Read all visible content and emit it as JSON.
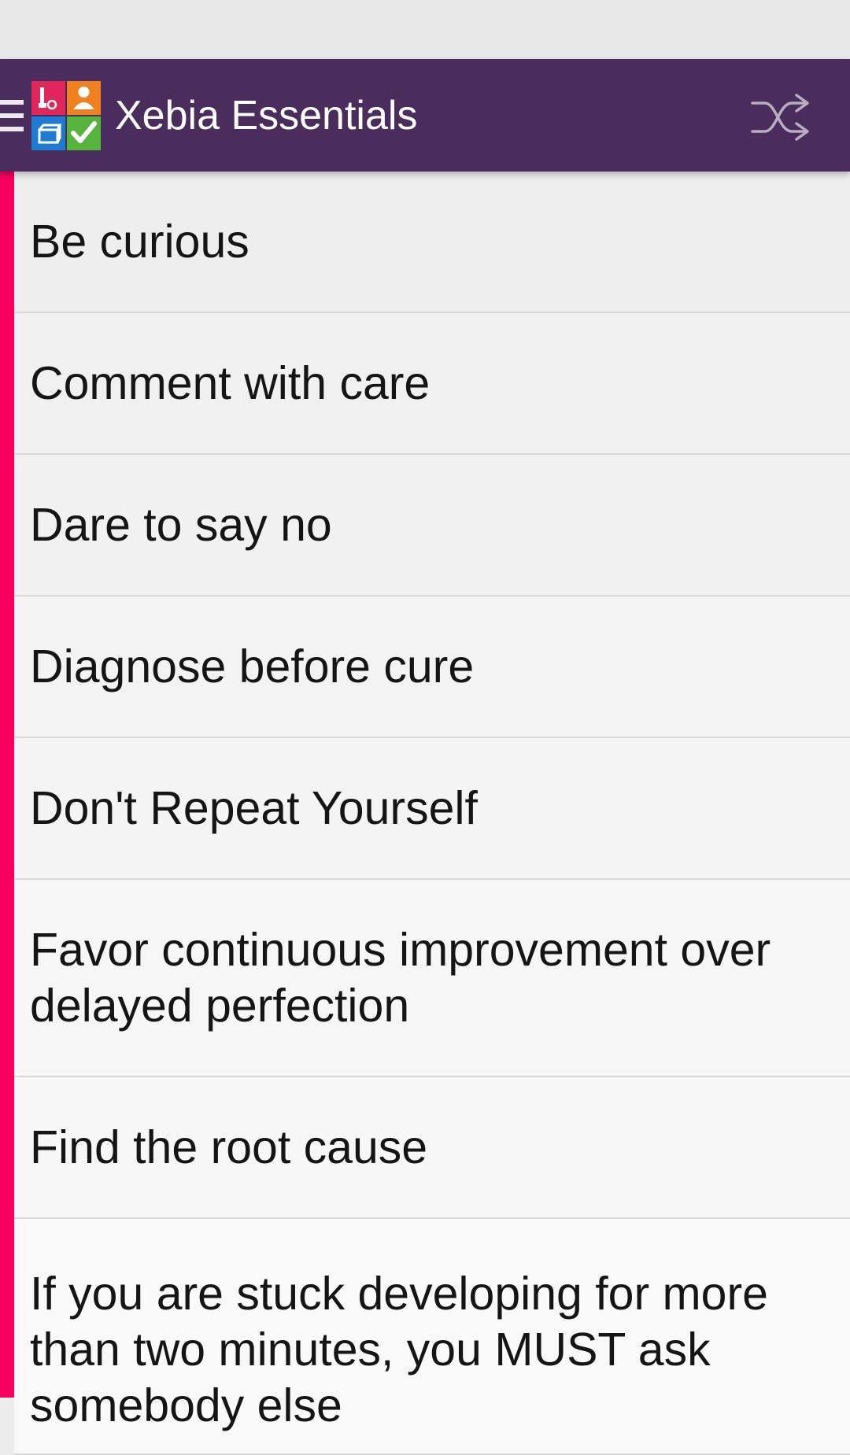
{
  "app_bar": {
    "title": "Xebia Essentials",
    "colors": {
      "background": "#4a2d5c",
      "title": "#ffffff"
    },
    "icons": {
      "menu": "menu-icon",
      "logo": "app-logo",
      "shuffle": "shuffle-icon"
    }
  },
  "list": {
    "accent_color": "#f5005f",
    "items": [
      "Be curious",
      "Comment with care",
      "Dare to say no",
      "Diagnose before cure",
      "Don't Repeat Yourself",
      "Favor continuous improvement over delayed perfection",
      "Find the root cause",
      "If you are stuck developing for more than two minutes, you MUST ask somebody else"
    ]
  }
}
